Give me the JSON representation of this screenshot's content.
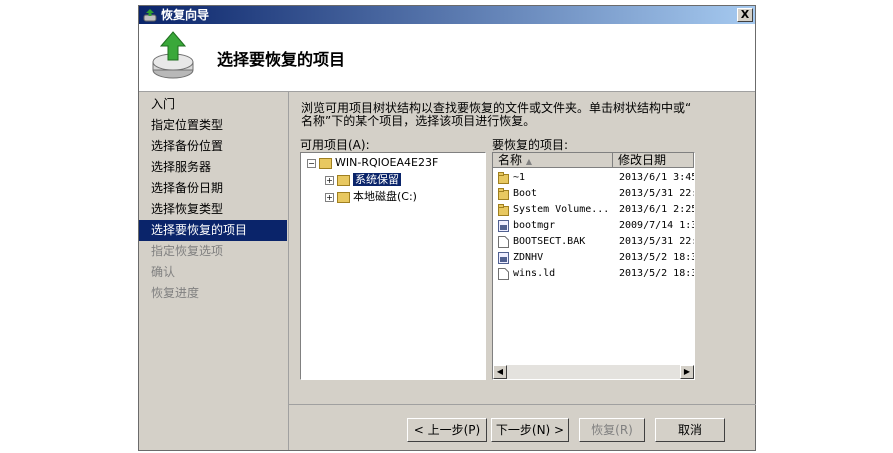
{
  "window": {
    "title": "恢复向导",
    "close_label": "X"
  },
  "header": {
    "title": "选择要恢复的项目"
  },
  "nav": {
    "items": [
      {
        "label": "入门",
        "state": "normal"
      },
      {
        "label": "指定位置类型",
        "state": "normal"
      },
      {
        "label": "选择备份位置",
        "state": "normal"
      },
      {
        "label": "选择服务器",
        "state": "normal"
      },
      {
        "label": "选择备份日期",
        "state": "normal"
      },
      {
        "label": "选择恢复类型",
        "state": "normal"
      },
      {
        "label": "选择要恢复的项目",
        "state": "active"
      },
      {
        "label": "指定恢复选项",
        "state": "disabled"
      },
      {
        "label": "确认",
        "state": "disabled"
      },
      {
        "label": "恢复进度",
        "state": "disabled"
      }
    ]
  },
  "main": {
    "description_line1": "浏览可用项目树状结构以查找要恢复的文件或文件夹。单击树状结构中或“",
    "description_line2": "名称”下的某个项目，选择该项目进行恢复。",
    "available_label": "可用项目(A):",
    "restore_label": "要恢复的项目:"
  },
  "tree": {
    "root": "WIN-RQIOEA4E23F",
    "children": [
      "系统保留",
      "本地磁盘(C:)"
    ],
    "selected": "系统保留"
  },
  "list": {
    "col_name": "名称",
    "col_date": "修改日期",
    "rows": [
      {
        "name": "~1",
        "date": "2013/6/1 3:45",
        "icon": "folder-icon"
      },
      {
        "name": "Boot",
        "date": "2013/5/31 22:",
        "icon": "folder-icon"
      },
      {
        "name": "System Volume...",
        "date": "2013/6/1 2:25",
        "icon": "folder-icon"
      },
      {
        "name": "bootmgr",
        "date": "2009/7/14 1:3",
        "icon": "system-file-icon"
      },
      {
        "name": "BOOTSECT.BAK",
        "date": "2013/5/31 22:",
        "icon": "file-icon"
      },
      {
        "name": "ZDNHV",
        "date": "2013/5/2 18:3",
        "icon": "system-file-icon"
      },
      {
        "name": "wins.ld",
        "date": "2013/5/2 18:3",
        "icon": "file-icon"
      }
    ]
  },
  "buttons": {
    "back": "< 上一步(P)",
    "next": "下一步(N) >",
    "restore": "恢复(R)",
    "cancel": "取消"
  },
  "colors": {
    "selection": "#0a246a",
    "dialog_bg": "#d4d0c8"
  }
}
